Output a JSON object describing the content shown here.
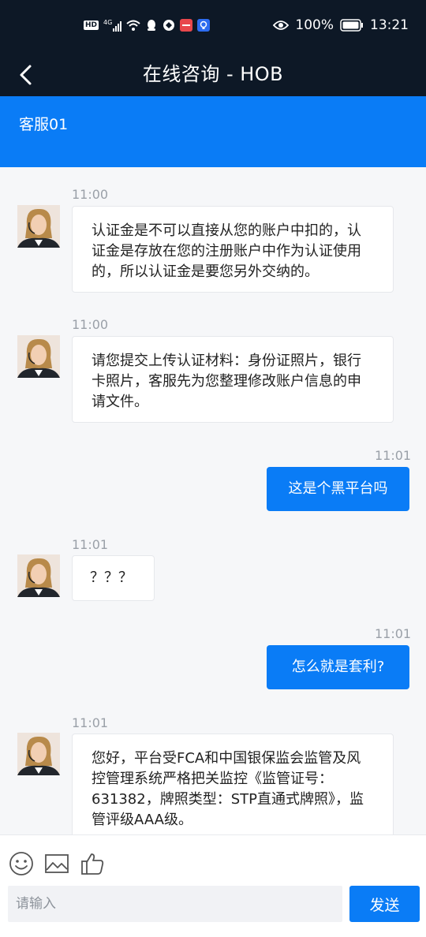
{
  "status_bar": {
    "network_badge": "HD",
    "signal_label": "4G",
    "battery": "100%",
    "time": "13:21"
  },
  "header": {
    "title": "在线咨询 - HOB",
    "back_icon": "chevron-left-icon"
  },
  "agent_bar": {
    "name": "客服01"
  },
  "messages": [
    {
      "side": "agent",
      "time": "11:00",
      "text": "认证金是不可以直接从您的账户中扣的，认证金是存放在您的注册账户中作为认证使用的，所以认证金是要您另外交纳的。"
    },
    {
      "side": "agent",
      "time": "11:00",
      "text": "请您提交上传认证材料：身份证照片，银行卡照片，客服先为您整理修改账户信息的申请文件。"
    },
    {
      "side": "user",
      "time": "11:01",
      "text": "这是个黑平台吗"
    },
    {
      "side": "agent",
      "time": "11:01",
      "text": "？？？"
    },
    {
      "side": "user",
      "time": "11:01",
      "text": "怎么就是套利?"
    },
    {
      "side": "agent",
      "time": "11:01",
      "text": "您好，平台受FCA和中国银保监会监管及风控管理系统严格把关监控《监管证号：631382，牌照类型：STP直通式牌照》，监管评级AAA级。"
    }
  ],
  "composer": {
    "tools": [
      "smiley-icon",
      "image-icon",
      "thumbs-up-icon"
    ],
    "placeholder": "请输入",
    "value": "",
    "send_label": "发送"
  },
  "colors": {
    "accent": "#0a7cf6",
    "dark": "#0d1826",
    "bg": "#f6f7f9"
  }
}
